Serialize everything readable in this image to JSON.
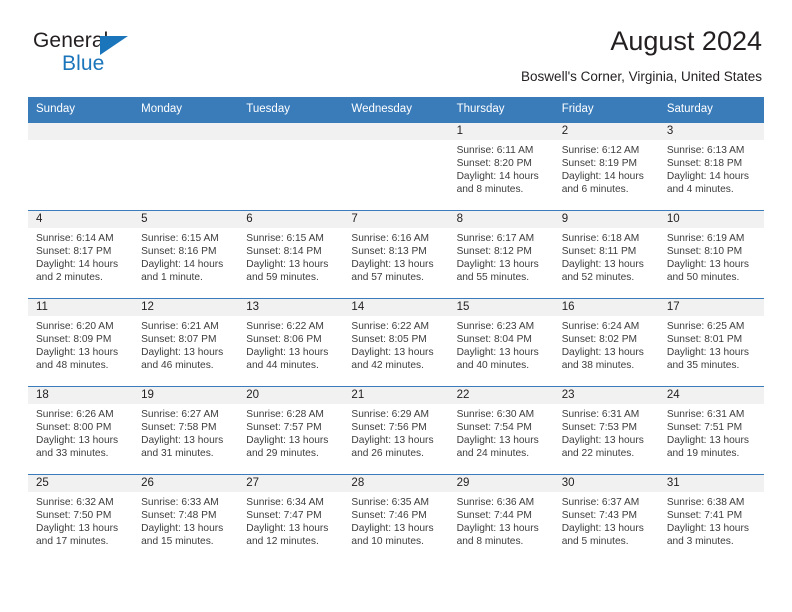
{
  "brand": {
    "word_general": "General",
    "word_blue": "Blue",
    "triangle_color": "#1b75bb"
  },
  "header": {
    "title": "August 2024",
    "subtitle": "Boswell's Corner, Virginia, United States"
  },
  "theme": {
    "header_blue": "#3a7cba",
    "daynum_gray": "#f1f1f1",
    "text": "#231f20"
  },
  "weekdays": [
    "Sunday",
    "Monday",
    "Tuesday",
    "Wednesday",
    "Thursday",
    "Friday",
    "Saturday"
  ],
  "weeks": [
    [
      {
        "day": "",
        "lines": []
      },
      {
        "day": "",
        "lines": []
      },
      {
        "day": "",
        "lines": []
      },
      {
        "day": "",
        "lines": []
      },
      {
        "day": "1",
        "lines": [
          "Sunrise: 6:11 AM",
          "Sunset: 8:20 PM",
          "Daylight: 14 hours",
          "and 8 minutes."
        ]
      },
      {
        "day": "2",
        "lines": [
          "Sunrise: 6:12 AM",
          "Sunset: 8:19 PM",
          "Daylight: 14 hours",
          "and 6 minutes."
        ]
      },
      {
        "day": "3",
        "lines": [
          "Sunrise: 6:13 AM",
          "Sunset: 8:18 PM",
          "Daylight: 14 hours",
          "and 4 minutes."
        ]
      }
    ],
    [
      {
        "day": "4",
        "lines": [
          "Sunrise: 6:14 AM",
          "Sunset: 8:17 PM",
          "Daylight: 14 hours",
          "and 2 minutes."
        ]
      },
      {
        "day": "5",
        "lines": [
          "Sunrise: 6:15 AM",
          "Sunset: 8:16 PM",
          "Daylight: 14 hours",
          "and 1 minute."
        ]
      },
      {
        "day": "6",
        "lines": [
          "Sunrise: 6:15 AM",
          "Sunset: 8:14 PM",
          "Daylight: 13 hours",
          "and 59 minutes."
        ]
      },
      {
        "day": "7",
        "lines": [
          "Sunrise: 6:16 AM",
          "Sunset: 8:13 PM",
          "Daylight: 13 hours",
          "and 57 minutes."
        ]
      },
      {
        "day": "8",
        "lines": [
          "Sunrise: 6:17 AM",
          "Sunset: 8:12 PM",
          "Daylight: 13 hours",
          "and 55 minutes."
        ]
      },
      {
        "day": "9",
        "lines": [
          "Sunrise: 6:18 AM",
          "Sunset: 8:11 PM",
          "Daylight: 13 hours",
          "and 52 minutes."
        ]
      },
      {
        "day": "10",
        "lines": [
          "Sunrise: 6:19 AM",
          "Sunset: 8:10 PM",
          "Daylight: 13 hours",
          "and 50 minutes."
        ]
      }
    ],
    [
      {
        "day": "11",
        "lines": [
          "Sunrise: 6:20 AM",
          "Sunset: 8:09 PM",
          "Daylight: 13 hours",
          "and 48 minutes."
        ]
      },
      {
        "day": "12",
        "lines": [
          "Sunrise: 6:21 AM",
          "Sunset: 8:07 PM",
          "Daylight: 13 hours",
          "and 46 minutes."
        ]
      },
      {
        "day": "13",
        "lines": [
          "Sunrise: 6:22 AM",
          "Sunset: 8:06 PM",
          "Daylight: 13 hours",
          "and 44 minutes."
        ]
      },
      {
        "day": "14",
        "lines": [
          "Sunrise: 6:22 AM",
          "Sunset: 8:05 PM",
          "Daylight: 13 hours",
          "and 42 minutes."
        ]
      },
      {
        "day": "15",
        "lines": [
          "Sunrise: 6:23 AM",
          "Sunset: 8:04 PM",
          "Daylight: 13 hours",
          "and 40 minutes."
        ]
      },
      {
        "day": "16",
        "lines": [
          "Sunrise: 6:24 AM",
          "Sunset: 8:02 PM",
          "Daylight: 13 hours",
          "and 38 minutes."
        ]
      },
      {
        "day": "17",
        "lines": [
          "Sunrise: 6:25 AM",
          "Sunset: 8:01 PM",
          "Daylight: 13 hours",
          "and 35 minutes."
        ]
      }
    ],
    [
      {
        "day": "18",
        "lines": [
          "Sunrise: 6:26 AM",
          "Sunset: 8:00 PM",
          "Daylight: 13 hours",
          "and 33 minutes."
        ]
      },
      {
        "day": "19",
        "lines": [
          "Sunrise: 6:27 AM",
          "Sunset: 7:58 PM",
          "Daylight: 13 hours",
          "and 31 minutes."
        ]
      },
      {
        "day": "20",
        "lines": [
          "Sunrise: 6:28 AM",
          "Sunset: 7:57 PM",
          "Daylight: 13 hours",
          "and 29 minutes."
        ]
      },
      {
        "day": "21",
        "lines": [
          "Sunrise: 6:29 AM",
          "Sunset: 7:56 PM",
          "Daylight: 13 hours",
          "and 26 minutes."
        ]
      },
      {
        "day": "22",
        "lines": [
          "Sunrise: 6:30 AM",
          "Sunset: 7:54 PM",
          "Daylight: 13 hours",
          "and 24 minutes."
        ]
      },
      {
        "day": "23",
        "lines": [
          "Sunrise: 6:31 AM",
          "Sunset: 7:53 PM",
          "Daylight: 13 hours",
          "and 22 minutes."
        ]
      },
      {
        "day": "24",
        "lines": [
          "Sunrise: 6:31 AM",
          "Sunset: 7:51 PM",
          "Daylight: 13 hours",
          "and 19 minutes."
        ]
      }
    ],
    [
      {
        "day": "25",
        "lines": [
          "Sunrise: 6:32 AM",
          "Sunset: 7:50 PM",
          "Daylight: 13 hours",
          "and 17 minutes."
        ]
      },
      {
        "day": "26",
        "lines": [
          "Sunrise: 6:33 AM",
          "Sunset: 7:48 PM",
          "Daylight: 13 hours",
          "and 15 minutes."
        ]
      },
      {
        "day": "27",
        "lines": [
          "Sunrise: 6:34 AM",
          "Sunset: 7:47 PM",
          "Daylight: 13 hours",
          "and 12 minutes."
        ]
      },
      {
        "day": "28",
        "lines": [
          "Sunrise: 6:35 AM",
          "Sunset: 7:46 PM",
          "Daylight: 13 hours",
          "and 10 minutes."
        ]
      },
      {
        "day": "29",
        "lines": [
          "Sunrise: 6:36 AM",
          "Sunset: 7:44 PM",
          "Daylight: 13 hours",
          "and 8 minutes."
        ]
      },
      {
        "day": "30",
        "lines": [
          "Sunrise: 6:37 AM",
          "Sunset: 7:43 PM",
          "Daylight: 13 hours",
          "and 5 minutes."
        ]
      },
      {
        "day": "31",
        "lines": [
          "Sunrise: 6:38 AM",
          "Sunset: 7:41 PM",
          "Daylight: 13 hours",
          "and 3 minutes."
        ]
      }
    ]
  ]
}
